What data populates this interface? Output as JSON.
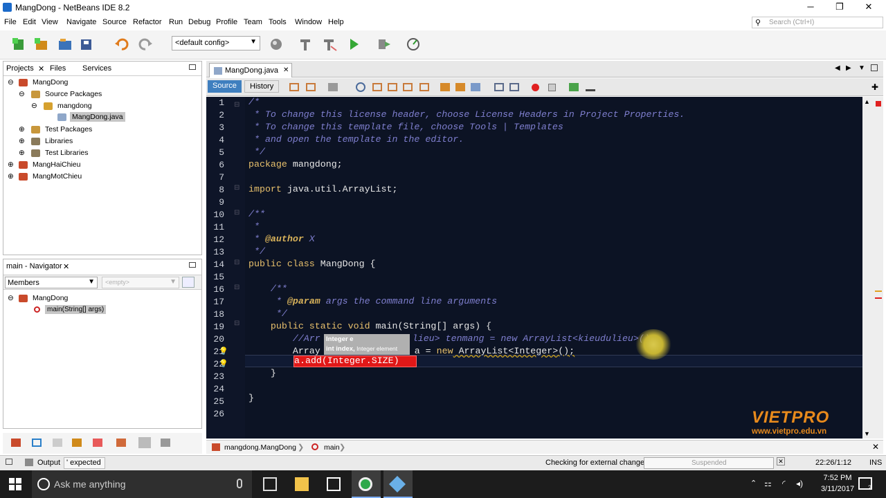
{
  "window": {
    "title": "MangDong - NetBeans IDE 8.2",
    "min_glyph": "─",
    "max_glyph": "❐",
    "close_glyph": "✕"
  },
  "menu": [
    "File",
    "Edit",
    "View",
    "Navigate",
    "Source",
    "Refactor",
    "Run",
    "Debug",
    "Profile",
    "Team",
    "Tools",
    "Window",
    "Help"
  ],
  "search": {
    "placeholder": "Search (Ctrl+I)"
  },
  "toolbar": {
    "config": "<default config>"
  },
  "projects_panel": {
    "tabs": [
      "Projects",
      "Files",
      "Services"
    ],
    "tree": [
      {
        "label": "MangDong"
      },
      {
        "label": "Source Packages"
      },
      {
        "label": "mangdong"
      },
      {
        "label": "MangDong.java"
      },
      {
        "label": "Test Packages"
      },
      {
        "label": "Libraries"
      },
      {
        "label": "Test Libraries"
      },
      {
        "label": "MangHaiChieu"
      },
      {
        "label": "MangMotChieu"
      }
    ]
  },
  "navigator": {
    "title": "main - Navigator",
    "filter": "Members",
    "filter2": "<empty>",
    "tree": [
      {
        "label": "MangDong"
      },
      {
        "label": "main(String[] args)"
      }
    ]
  },
  "editor": {
    "tab": "MangDong.java",
    "source_label": "Source",
    "history_label": "History",
    "line_numbers": [
      "1",
      "2",
      "3",
      "4",
      "5",
      "6",
      "7",
      "8",
      "9",
      "10",
      "11",
      "12",
      "13",
      "14",
      "15",
      "16",
      "17",
      "18",
      "19",
      "20",
      "21",
      "22",
      "23",
      "24",
      "25",
      "26"
    ],
    "code": {
      "l1": "/*",
      "l2": " * To change this license header, choose License Headers in Project Properties.",
      "l3": " * To change this template file, choose Tools | Templates",
      "l4": " * and open the template in the editor.",
      "l5": " */",
      "l6_kw": "package",
      "l6": " mangdong;",
      "l8_kw": "import",
      "l8": " java.util.ArrayList;",
      "l10": "/**",
      "l11": " *",
      "l12_a": " * ",
      "l12_ann": "@author",
      "l12_b": " X",
      "l13": " */",
      "l14_kw": "public class",
      "l14": " MangDong {",
      "l16": "    /**",
      "l17_a": "     * ",
      "l17_ann": "@param",
      "l17_b": " args the command line arguments",
      "l18": "     */",
      "l19_kw": "    public static void",
      "l19": " main(String[] args) {",
      "l20_a": "        //Arr",
      "l20_b": "lieu> tenmang = new ArrayList<kieudulieu>();",
      "l21_a": "        Array",
      "l21_b": " a = ",
      "l21_kw": "new",
      "l21_c": " ArrayList<Integer>();",
      "l22": "a.add(Integer.SIZE)",
      "l23": "    }",
      "l25": "}"
    },
    "tooltip": {
      "line1": "Integer e",
      "line2_bold": "int index,",
      "line2": " Integer element"
    }
  },
  "watermark": {
    "brand": "VIETPRO",
    "url": "www.vietpro.edu.vn"
  },
  "breadcrumb": {
    "class": "mangdong.MangDong",
    "method": "main"
  },
  "status": {
    "output_label": "Output",
    "output_text": "' expected",
    "checking": "Checking for external changes",
    "progress": "Suspended",
    "position": "22:26/1:12",
    "mode": "INS"
  },
  "taskbar": {
    "cortana": "Ask me anything",
    "time": "7:52 PM",
    "date": "3/11/2017",
    "notif_count": "2"
  }
}
